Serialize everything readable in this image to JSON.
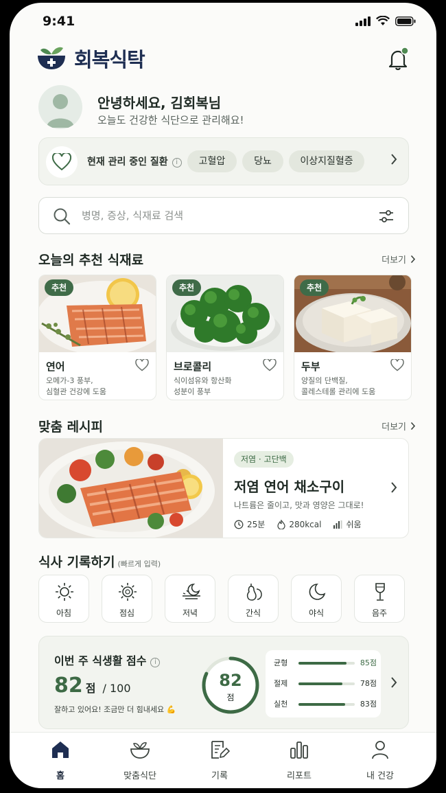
{
  "status_bar": {
    "time": "9:41"
  },
  "header": {
    "app_title": "회복식탁"
  },
  "greeting": {
    "title": "안녕하세요, 김회복님",
    "subtitle": "오늘도 건강한 식단으로 관리해요!"
  },
  "conditions": {
    "label": "현재 관리 중인 질환",
    "chips": [
      "고혈압",
      "당뇨",
      "이상지질혈증"
    ]
  },
  "search": {
    "placeholder": "병명, 증상, 식재료 검색"
  },
  "ingredients": {
    "title": "오늘의 추천 식재료",
    "more": "더보기",
    "badge": "추천",
    "items": [
      {
        "name": "연어",
        "desc1": "오메가-3 풍부,",
        "desc2": "심혈관 건강에 도움"
      },
      {
        "name": "브로콜리",
        "desc1": "식이섬유와 항산화",
        "desc2": "성분이 풍부"
      },
      {
        "name": "두부",
        "desc1": "양질의 단백질,",
        "desc2": "콜레스테롤 관리에 도움"
      }
    ]
  },
  "recipe": {
    "title": "맞춤 레시피",
    "more": "더보기",
    "tag": "저염 · 고단백",
    "name": "저염 연어 채소구이",
    "subtitle": "나트륨은 줄이고, 맛과 영양은 그대로!",
    "time": "25분",
    "kcal": "280kcal",
    "difficulty": "쉬움"
  },
  "meal_log": {
    "title": "식사 기록하기",
    "hint": "(빠르게 입력)",
    "items": [
      "아침",
      "점심",
      "저녁",
      "간식",
      "야식",
      "음주"
    ]
  },
  "score": {
    "title": "이번 주 식생활 점수",
    "value": "82",
    "unit": "점",
    "max": "/ 100",
    "message": "잘하고 있어요! 조금만 더 힘내세요 💪",
    "ring_value": "82",
    "ring_unit": "점",
    "ring_fraction": 0.82,
    "bars": [
      {
        "label": "균형",
        "value": "85점",
        "fraction": 0.85,
        "highlight": true
      },
      {
        "label": "절제",
        "value": "78점",
        "fraction": 0.78,
        "highlight": false
      },
      {
        "label": "실천",
        "value": "83점",
        "fraction": 0.83,
        "highlight": false
      }
    ]
  },
  "nav": {
    "items": [
      "홈",
      "맞춤식단",
      "기록",
      "리포트",
      "내 건강"
    ],
    "active": "홈"
  },
  "colors": {
    "primary": "#3d6a45",
    "navy": "#1e2e52",
    "background": "#fbfbf9"
  }
}
